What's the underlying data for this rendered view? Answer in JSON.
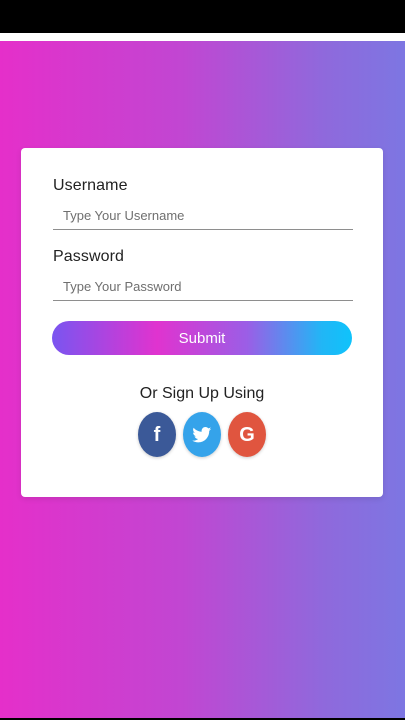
{
  "form": {
    "username_label": "Username",
    "username_placeholder": "Type Your Username",
    "password_label": "Password",
    "password_placeholder": "Type Your Password",
    "submit_label": "Submit"
  },
  "social": {
    "heading": "Or Sign Up Using",
    "buttons": [
      {
        "icon": "facebook-icon",
        "glyph": "f",
        "color": "#3b5998"
      },
      {
        "icon": "twitter-icon",
        "color": "#35a3ea"
      },
      {
        "icon": "google-icon",
        "glyph": "G",
        "color": "#e0553f"
      }
    ]
  },
  "colors": {
    "background_gradient_start": "#e52fca",
    "background_gradient_end": "#7d76e2",
    "button_gradient_start": "#7a55f0",
    "button_gradient_end": "#0fc3fb"
  }
}
